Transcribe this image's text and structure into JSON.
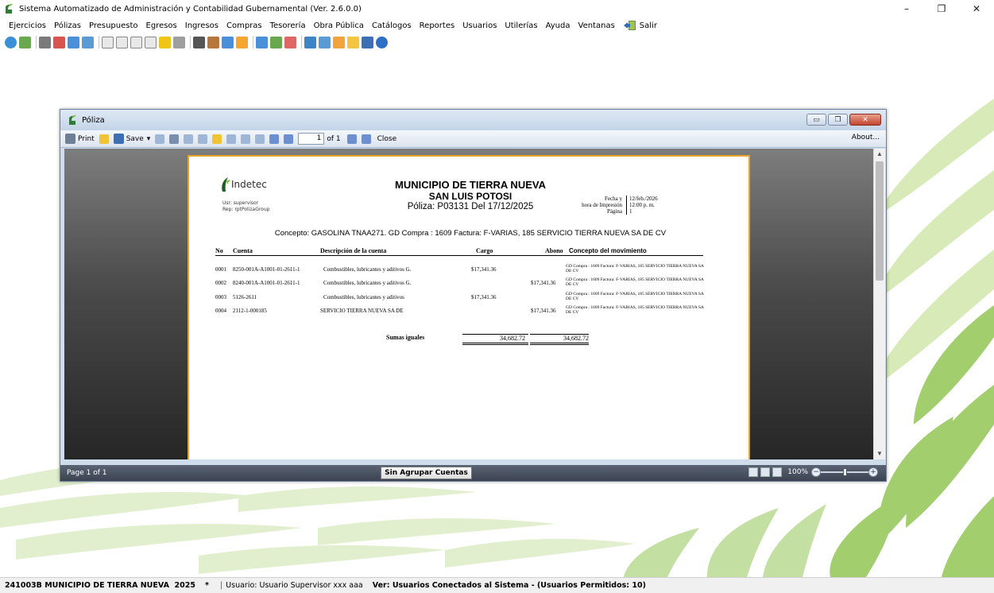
{
  "app": {
    "title": "Sistema Automatizado de Administración y Contabilidad Gubernamental (Ver. 2.6.0.0)",
    "window_controls": [
      "–",
      "❐",
      "✕"
    ]
  },
  "menu": {
    "items": [
      "Ejercicios",
      "Pólizas",
      "Presupuesto",
      "Egresos",
      "Ingresos",
      "Compras",
      "Tesorería",
      "Obra Pública",
      "Catálogos",
      "Reportes",
      "Usuarios",
      "Utilerías",
      "Ayuda",
      "Ventanas"
    ],
    "salir_label": "Salir"
  },
  "poliza_window": {
    "title": "Póliza",
    "controls": [
      "▭",
      "❐",
      "✕"
    ]
  },
  "viewer_toolbar": {
    "print_label": "Print",
    "save_label": "Save",
    "save_dropdown": "▾",
    "page_value": "1",
    "of_label": "of 1",
    "close_label": "Close",
    "about_label": "About..."
  },
  "report": {
    "logo_text": "Indetec",
    "usr_line": "Usr: supervisor",
    "rep_line": "Rep: rptPolizaGroup",
    "title_line1": "MUNICIPIO DE TIERRA NUEVA",
    "title_line2": "SAN LUIS POTOSI",
    "title_line3": "Póliza:  P03131  Del 17/12/2025",
    "meta": {
      "fecha_label": "Fecha y",
      "impresion_label": "hora de Impresión",
      "pagina_label": "Página",
      "fecha_value": "12/feb./2026",
      "hora_value": "12:00 p. m.",
      "pagina_value": "1"
    },
    "concepto": "Concepto: GASOLINA TNAA271. GD Compra : 1609 Factura: F-VARIAS, 185 SERVICIO TIERRA NUEVA SA DE CV",
    "columns": {
      "no": "No",
      "cuenta": "Cuenta",
      "descripcion": "Descripción de la cuenta",
      "cargo": "Cargo",
      "abono": "Abono",
      "concepto": "Concepto del movimiento"
    },
    "rows": [
      {
        "no": "0001",
        "cuenta": "8250-001A-A1001-01-2611-1",
        "descripcion": "Combustibles, lubricantes y aditivos G.",
        "cargo": "$17,341.36",
        "abono": "",
        "concepto": "GD Compra : 1609 Factura: F-VARIAS, 185 SERVICIO TIERRA NUEVA SA DE CV"
      },
      {
        "no": "0002",
        "cuenta": "8240-001A-A1001-01-2611-1",
        "descripcion": "Combustibles, lubricantes y aditivos G.",
        "cargo": "",
        "abono": "$17,341.36",
        "concepto": "GD Compra : 1609 Factura: F-VARIAS, 185 SERVICIO TIERRA NUEVA SA DE CV"
      },
      {
        "no": "0003",
        "cuenta": "5126-2611",
        "descripcion": "Combustibles, lubricantes y aditivos",
        "cargo": "$17,341.36",
        "abono": "",
        "concepto": "GD Compra : 1609 Factura: F-VARIAS, 185 SERVICIO TIERRA NUEVA SA DE CV"
      },
      {
        "no": "0004",
        "cuenta": "2112-1-000185",
        "descripcion": "SERVICIO TIERRA NUEVA SA DE",
        "cargo": "",
        "abono": "$17,341.36",
        "concepto": "GD Compra : 1609 Factura: F-VARIAS, 185 SERVICIO TIERRA NUEVA SA DE CV"
      }
    ],
    "totals": {
      "label": "Sumas iguales",
      "cargo": "34,682.72",
      "abono": "34,682.72"
    }
  },
  "viewer_status": {
    "page_label": "Page 1 of 1",
    "group_button": "Sin Agrupar Cuentas",
    "zoom_label": "100%",
    "zoom_value_percent": 100,
    "zoom_slider_fraction": 0.5
  },
  "statusbar": {
    "municipio": "241003B MUNICIPIO DE TIERRA NUEVA  2025",
    "star": "*",
    "separator": "|",
    "usuario": "Usuario: Usuario Supervisor xxx aaa",
    "conectados": "Ver: Usuarios Conectados al Sistema - (Usuarios Permitidos: 10)"
  },
  "colors": {
    "accent_green": "#7bbf3a",
    "page_border": "#e6a42a",
    "viewer_status_bg": "#3b4352"
  }
}
